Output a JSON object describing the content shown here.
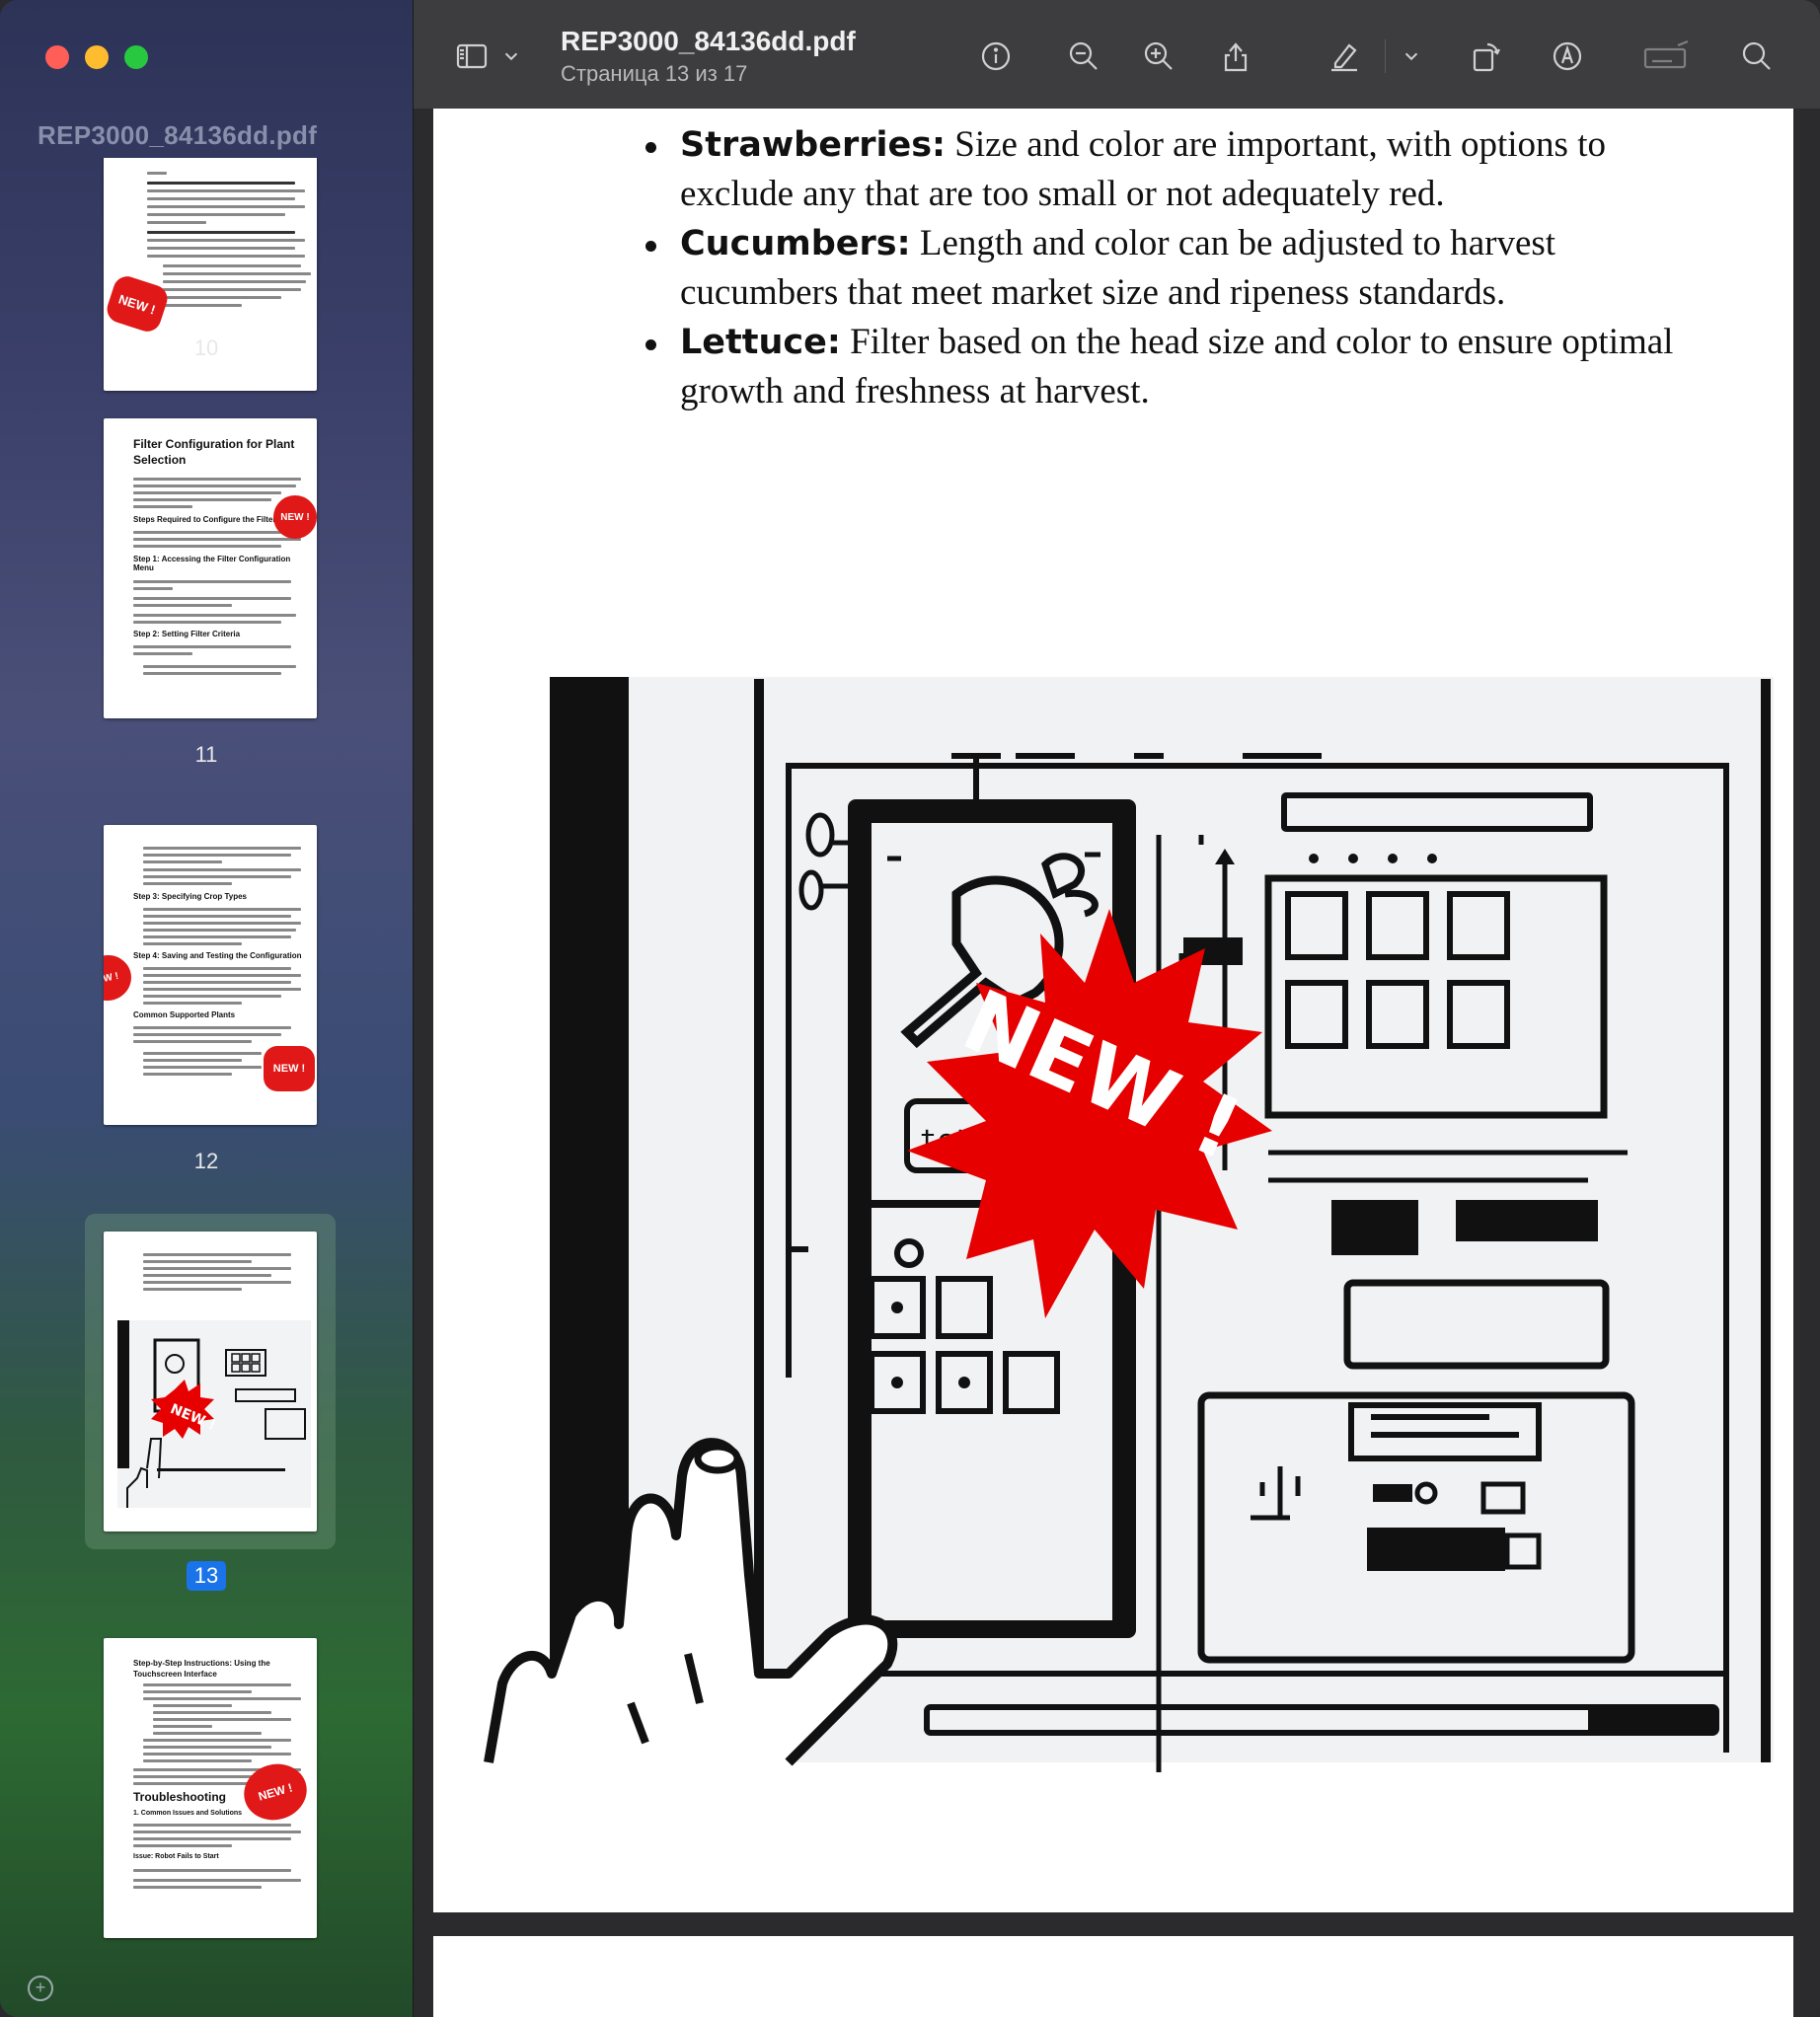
{
  "window": {
    "file_name": "REP3000_84136dd.pdf",
    "page_indicator": "Страница 13 из 17"
  },
  "sidebar": {
    "title": "REP3000_84136dd.pdf",
    "thumbnails": [
      {
        "page": "10",
        "lines": [
          "Filter Configuration for Plant Selection: Set up the filters in the software to specify which plants to harvest and which to leave.",
          "Testing and Adjustment: After the initial configuration, conduct a test run in a controlled section of your farm.",
          "By the end of these detailed steps, your harvesting robot will be finely tuned."
        ],
        "badge": "NEW !"
      },
      {
        "page": "11",
        "heading": "Filter Configuration for Plant Selection",
        "subheadings": [
          "Steps Required to Configure the Filter",
          "Step 1: Accessing the Filter Configuration Menu",
          "Step 2: Setting Filter Criteria"
        ],
        "badge": "NEW !"
      },
      {
        "page": "12",
        "subheadings": [
          "Step 3: Specifying Crop Types",
          "Step 4: Saving and Testing the Configuration",
          "Common Supported Plants"
        ],
        "badge": "NEW !"
      },
      {
        "page": "13",
        "selected": true,
        "badge": "NEW !"
      },
      {
        "page": "14",
        "heading": "Step-by-Step Instructions: Using the Touchscreen Interface",
        "subheadings": [
          "Troubleshooting",
          "1. Common Issues and Solutions",
          "Issue: Robot Fails to Start"
        ],
        "badge": "NEW !"
      }
    ]
  },
  "toolbar": {
    "icons": [
      "sidebar-toggle-icon",
      "chevron-down-icon",
      "info-icon",
      "zoom-out-icon",
      "zoom-in-icon",
      "share-icon",
      "highlight-icon",
      "chevron-down-icon",
      "rotate-icon",
      "markup-icon",
      "signature-icon",
      "search-icon"
    ]
  },
  "page": {
    "bullets": [
      {
        "term": "Strawberries:",
        "text": " Size and color are important, with options to exclude any that are too small or not adequately red."
      },
      {
        "term": "Cucumbers:",
        "text": " Length and color can be adjusted to harvest cucumbers that meet market size and ripeness standards."
      },
      {
        "term": "Lettuce:",
        "text": " Filter based on the head size and color to ensure optimal growth and freshness at harvest."
      }
    ],
    "illustration": {
      "screen_text": "tctf{so",
      "badge": "NEW !"
    }
  },
  "colors": {
    "badge_red": "#e60000",
    "selection_blue": "#1a73e8"
  }
}
